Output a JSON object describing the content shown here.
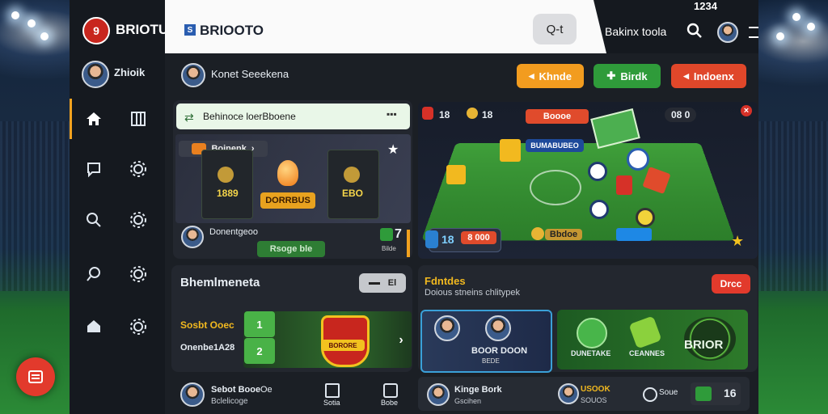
{
  "window": {
    "status_time": "1234"
  },
  "brand": {
    "sidebar_name": "BRIOTU",
    "logo_digit": "9",
    "header_name": "BRIOOTO",
    "header_mark": "S"
  },
  "search": {
    "label": "Q-t"
  },
  "header_right": {
    "link": "Bakinx toola"
  },
  "user": {
    "name": "Zhioik",
    "sub_name": "Konet Seeekena"
  },
  "actions": [
    {
      "label": "Khnde",
      "color": "#f29c1f"
    },
    {
      "label": "Birdk",
      "color": "#2f9b3a"
    },
    {
      "label": "Indoenx",
      "color": "#e0472a"
    }
  ],
  "promo_card": {
    "banner": "Behinoce loerBboene",
    "tag": "Boinenk",
    "left_score": "1889",
    "right_score": "EBO",
    "center_label": "DORRBUS",
    "player_name": "Donentgeoo",
    "cta": "Rsoge ble",
    "count": "7",
    "count_sub": "Bilde"
  },
  "pitch_card": {
    "badge1": "18",
    "badge2": "18",
    "top_left": "18",
    "top_right_label": "Boooe",
    "mid_label": "BUMABUBEO",
    "right_icons": "08 0",
    "bottom_left": "18",
    "bottom_left_label": "8 000",
    "bottom_center": "Bbdoe"
  },
  "bottom_left_panel": {
    "title": "Bhemlmeneta",
    "toggle": "El",
    "row1_label": "Sosbt Ooec",
    "row1_value": "1",
    "row2_label": "Onenbe1A28",
    "row2_value": "2",
    "club": "BORORE"
  },
  "bottom_right_panel": {
    "title": "Fdntdes",
    "subtitle": "Doious stneins chlitypek",
    "button": "Drcc",
    "player_card": "BOOR DOON",
    "player_card_sub": "BEDE",
    "green1": "DUNETAKE",
    "green2": "CEANNES",
    "green3": "BRIOR"
  },
  "footer": {
    "left_name": "Sebot Booe",
    "left_sub": "Bclelicoge",
    "left_badge": "Oe",
    "mid1": "Sotia",
    "mid2": "Bobe",
    "r_name": "Kinge Bork",
    "r_sub": "Gscihen",
    "r2_name": "USOOK",
    "r2_sub": "SOUOS",
    "r3": "Soue",
    "r_num": "16"
  },
  "fab": {
    "label": "menu"
  }
}
